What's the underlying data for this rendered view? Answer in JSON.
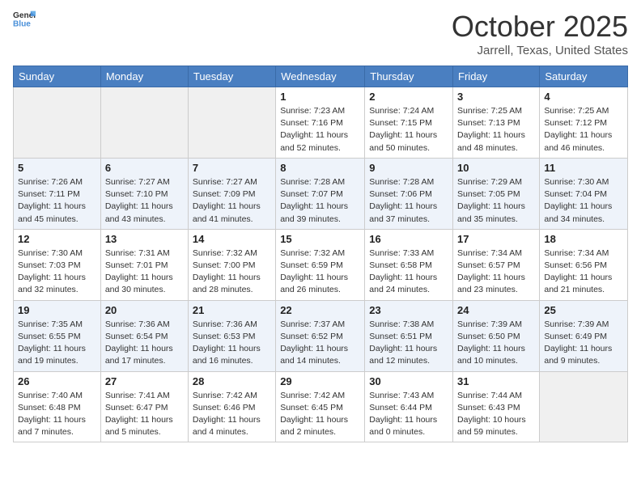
{
  "header": {
    "logo_general": "General",
    "logo_blue": "Blue",
    "month": "October 2025",
    "location": "Jarrell, Texas, United States"
  },
  "weekdays": [
    "Sunday",
    "Monday",
    "Tuesday",
    "Wednesday",
    "Thursday",
    "Friday",
    "Saturday"
  ],
  "weeks": [
    [
      {
        "day": "",
        "info": ""
      },
      {
        "day": "",
        "info": ""
      },
      {
        "day": "",
        "info": ""
      },
      {
        "day": "1",
        "info": "Sunrise: 7:23 AM\nSunset: 7:16 PM\nDaylight: 11 hours and 52 minutes."
      },
      {
        "day": "2",
        "info": "Sunrise: 7:24 AM\nSunset: 7:15 PM\nDaylight: 11 hours and 50 minutes."
      },
      {
        "day": "3",
        "info": "Sunrise: 7:25 AM\nSunset: 7:13 PM\nDaylight: 11 hours and 48 minutes."
      },
      {
        "day": "4",
        "info": "Sunrise: 7:25 AM\nSunset: 7:12 PM\nDaylight: 11 hours and 46 minutes."
      }
    ],
    [
      {
        "day": "5",
        "info": "Sunrise: 7:26 AM\nSunset: 7:11 PM\nDaylight: 11 hours and 45 minutes."
      },
      {
        "day": "6",
        "info": "Sunrise: 7:27 AM\nSunset: 7:10 PM\nDaylight: 11 hours and 43 minutes."
      },
      {
        "day": "7",
        "info": "Sunrise: 7:27 AM\nSunset: 7:09 PM\nDaylight: 11 hours and 41 minutes."
      },
      {
        "day": "8",
        "info": "Sunrise: 7:28 AM\nSunset: 7:07 PM\nDaylight: 11 hours and 39 minutes."
      },
      {
        "day": "9",
        "info": "Sunrise: 7:28 AM\nSunset: 7:06 PM\nDaylight: 11 hours and 37 minutes."
      },
      {
        "day": "10",
        "info": "Sunrise: 7:29 AM\nSunset: 7:05 PM\nDaylight: 11 hours and 35 minutes."
      },
      {
        "day": "11",
        "info": "Sunrise: 7:30 AM\nSunset: 7:04 PM\nDaylight: 11 hours and 34 minutes."
      }
    ],
    [
      {
        "day": "12",
        "info": "Sunrise: 7:30 AM\nSunset: 7:03 PM\nDaylight: 11 hours and 32 minutes."
      },
      {
        "day": "13",
        "info": "Sunrise: 7:31 AM\nSunset: 7:01 PM\nDaylight: 11 hours and 30 minutes."
      },
      {
        "day": "14",
        "info": "Sunrise: 7:32 AM\nSunset: 7:00 PM\nDaylight: 11 hours and 28 minutes."
      },
      {
        "day": "15",
        "info": "Sunrise: 7:32 AM\nSunset: 6:59 PM\nDaylight: 11 hours and 26 minutes."
      },
      {
        "day": "16",
        "info": "Sunrise: 7:33 AM\nSunset: 6:58 PM\nDaylight: 11 hours and 24 minutes."
      },
      {
        "day": "17",
        "info": "Sunrise: 7:34 AM\nSunset: 6:57 PM\nDaylight: 11 hours and 23 minutes."
      },
      {
        "day": "18",
        "info": "Sunrise: 7:34 AM\nSunset: 6:56 PM\nDaylight: 11 hours and 21 minutes."
      }
    ],
    [
      {
        "day": "19",
        "info": "Sunrise: 7:35 AM\nSunset: 6:55 PM\nDaylight: 11 hours and 19 minutes."
      },
      {
        "day": "20",
        "info": "Sunrise: 7:36 AM\nSunset: 6:54 PM\nDaylight: 11 hours and 17 minutes."
      },
      {
        "day": "21",
        "info": "Sunrise: 7:36 AM\nSunset: 6:53 PM\nDaylight: 11 hours and 16 minutes."
      },
      {
        "day": "22",
        "info": "Sunrise: 7:37 AM\nSunset: 6:52 PM\nDaylight: 11 hours and 14 minutes."
      },
      {
        "day": "23",
        "info": "Sunrise: 7:38 AM\nSunset: 6:51 PM\nDaylight: 11 hours and 12 minutes."
      },
      {
        "day": "24",
        "info": "Sunrise: 7:39 AM\nSunset: 6:50 PM\nDaylight: 11 hours and 10 minutes."
      },
      {
        "day": "25",
        "info": "Sunrise: 7:39 AM\nSunset: 6:49 PM\nDaylight: 11 hours and 9 minutes."
      }
    ],
    [
      {
        "day": "26",
        "info": "Sunrise: 7:40 AM\nSunset: 6:48 PM\nDaylight: 11 hours and 7 minutes."
      },
      {
        "day": "27",
        "info": "Sunrise: 7:41 AM\nSunset: 6:47 PM\nDaylight: 11 hours and 5 minutes."
      },
      {
        "day": "28",
        "info": "Sunrise: 7:42 AM\nSunset: 6:46 PM\nDaylight: 11 hours and 4 minutes."
      },
      {
        "day": "29",
        "info": "Sunrise: 7:42 AM\nSunset: 6:45 PM\nDaylight: 11 hours and 2 minutes."
      },
      {
        "day": "30",
        "info": "Sunrise: 7:43 AM\nSunset: 6:44 PM\nDaylight: 11 hours and 0 minutes."
      },
      {
        "day": "31",
        "info": "Sunrise: 7:44 AM\nSunset: 6:43 PM\nDaylight: 10 hours and 59 minutes."
      },
      {
        "day": "",
        "info": ""
      }
    ]
  ]
}
